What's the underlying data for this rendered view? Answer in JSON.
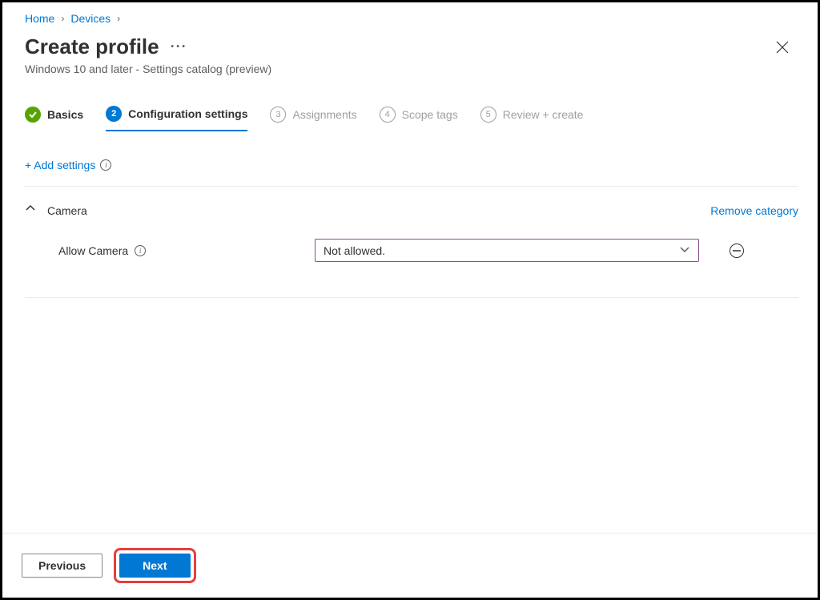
{
  "breadcrumb": {
    "items": [
      "Home",
      "Devices"
    ]
  },
  "header": {
    "title": "Create profile",
    "subtitle": "Windows 10 and later - Settings catalog (preview)"
  },
  "steps": [
    {
      "label": "Basics",
      "state": "completed"
    },
    {
      "label": "Configuration settings",
      "state": "active",
      "num": "2"
    },
    {
      "label": "Assignments",
      "state": "pending",
      "num": "3"
    },
    {
      "label": "Scope tags",
      "state": "pending",
      "num": "4"
    },
    {
      "label": "Review + create",
      "state": "pending",
      "num": "5"
    }
  ],
  "addSettings": {
    "label": "+ Add settings"
  },
  "category": {
    "name": "Camera",
    "removeLabel": "Remove category",
    "setting": {
      "label": "Allow Camera",
      "value": "Not allowed."
    }
  },
  "footer": {
    "previous": "Previous",
    "next": "Next"
  }
}
